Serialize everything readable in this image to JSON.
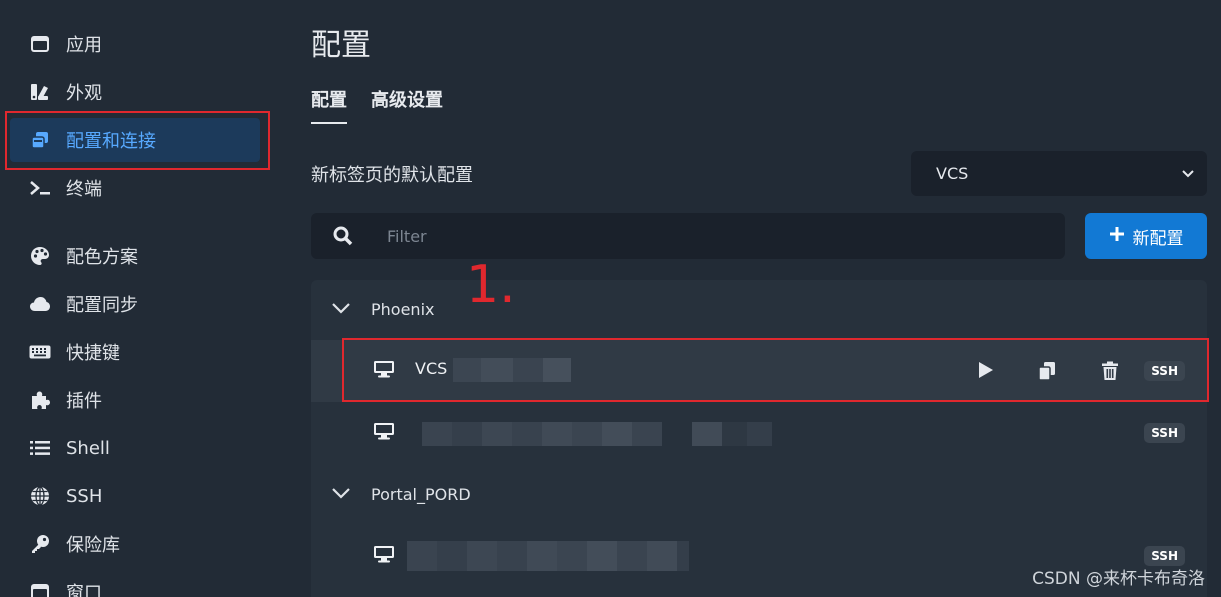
{
  "sidebar": {
    "items": [
      {
        "label": "应用",
        "icon": "window-icon"
      },
      {
        "label": "外观",
        "icon": "appearance-icon"
      },
      {
        "label": "配置和连接",
        "icon": "profiles-icon",
        "active": true
      },
      {
        "label": "终端",
        "icon": "terminal-icon"
      },
      {
        "label": "配色方案",
        "icon": "palette-icon"
      },
      {
        "label": "配置同步",
        "icon": "cloud-icon"
      },
      {
        "label": "快捷键",
        "icon": "keyboard-icon"
      },
      {
        "label": "插件",
        "icon": "puzzle-icon"
      },
      {
        "label": "Shell",
        "icon": "list-icon"
      },
      {
        "label": "SSH",
        "icon": "globe-icon"
      },
      {
        "label": "保险库",
        "icon": "key-icon"
      },
      {
        "label": "窗口",
        "icon": "window-icon"
      }
    ]
  },
  "main": {
    "title": "配置",
    "tabs": [
      {
        "label": "配置",
        "active": true
      },
      {
        "label": "高级设置",
        "active": false
      }
    ],
    "default_profile": {
      "label": "新标签页的默认配置",
      "value": "VCS"
    },
    "filter": {
      "placeholder": "Filter",
      "value": ""
    },
    "new_button": "新配置",
    "groups": [
      {
        "name": "Phoenix",
        "expanded": true,
        "profiles": [
          {
            "name": "VCS",
            "badge": "SSH",
            "selected": true
          },
          {
            "name": "",
            "badge": "SSH",
            "selected": false
          }
        ]
      },
      {
        "name": "Portal_PORD",
        "expanded": true,
        "profiles": [
          {
            "name": "",
            "badge": "SSH",
            "selected": false
          }
        ]
      }
    ]
  },
  "annotation": "1.",
  "watermark": "CSDN @来杯卡布奇洛",
  "colors": {
    "accent": "#1279d4",
    "active_bg": "#1c3a5b",
    "active_text": "#57a9ff",
    "highlight": "#e0282e",
    "bg": "#222b36"
  }
}
